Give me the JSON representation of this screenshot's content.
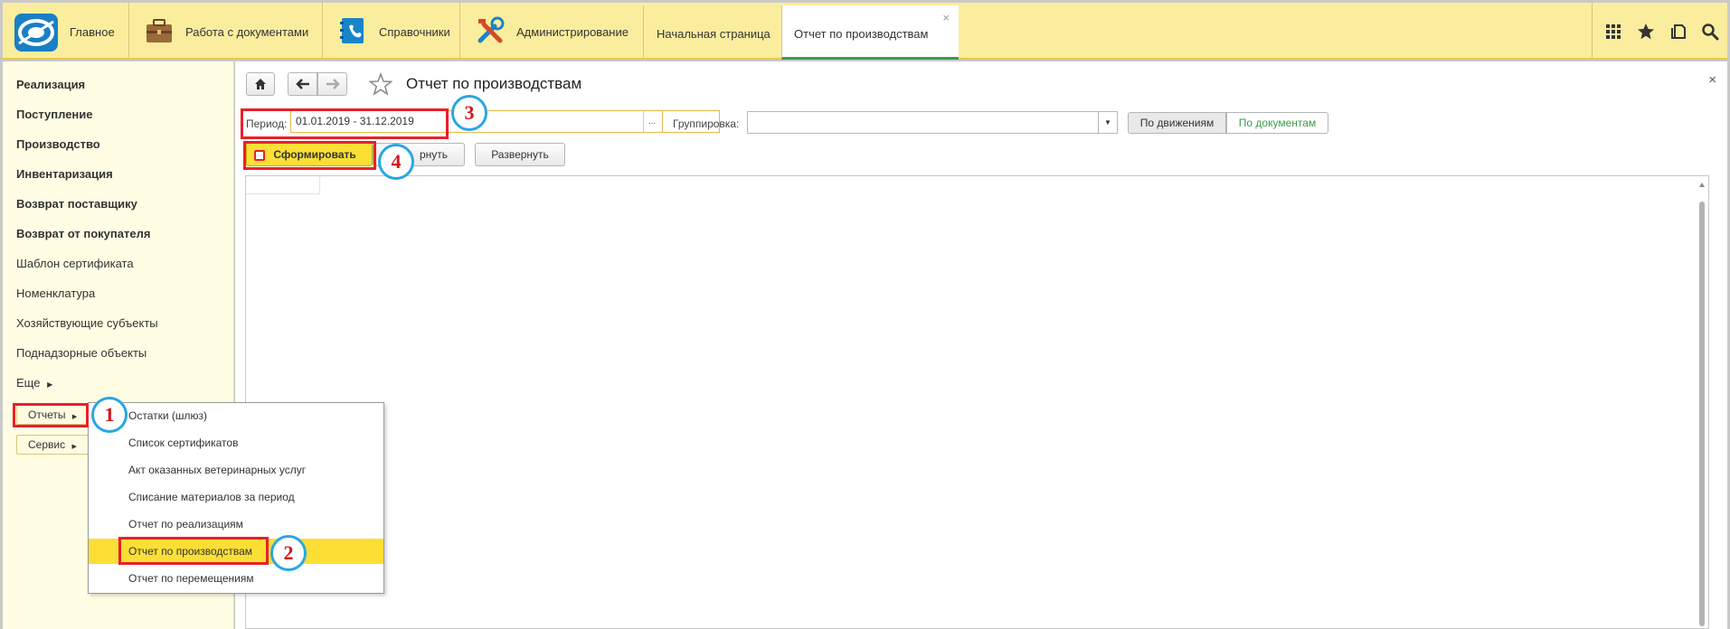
{
  "topbar": {
    "home_label": "Главное",
    "sections": [
      {
        "label": "Работа с документами",
        "icon": "briefcase-icon"
      },
      {
        "label": "Справочники",
        "icon": "address-book-icon"
      },
      {
        "label": "Администрирование",
        "icon": "tools-icon"
      }
    ],
    "tabs": [
      {
        "label": "Начальная страница"
      },
      {
        "label": "Отчет по производствам",
        "close": "×"
      }
    ],
    "right_icons": [
      "apps-grid-icon",
      "star-icon",
      "history-icon",
      "search-icon"
    ]
  },
  "sidebar": {
    "items": [
      {
        "label": "Реализация",
        "bold": true
      },
      {
        "label": "Поступление",
        "bold": true
      },
      {
        "label": "Производство",
        "bold": true
      },
      {
        "label": "Инвентаризация",
        "bold": true
      },
      {
        "label": "Возврат поставщику",
        "bold": true
      },
      {
        "label": "Возврат от покупателя",
        "bold": true
      },
      {
        "label": "Шаблон сертификата",
        "bold": false
      },
      {
        "label": "Номенклатура",
        "bold": false
      },
      {
        "label": "Хозяйствующие субъекты",
        "bold": false
      },
      {
        "label": "Поднадзорные объекты",
        "bold": false
      },
      {
        "label": "Еще",
        "bold": false
      }
    ],
    "reports_button": "Отчеты",
    "service_button": "Сервис"
  },
  "reports_menu": {
    "items": [
      "Остатки (шлюз)",
      "Список сертификатов",
      "Акт оказанных ветеринарных услуг",
      "Списание материалов за период",
      "Отчет по реализациям",
      "Отчет по производствам",
      "Отчет по перемещениям"
    ],
    "highlighted_index": 5
  },
  "main": {
    "title": "Отчет по производствам",
    "close": "×",
    "period_label": "Период:",
    "period_value": "01.01.2019 - 31.12.2019",
    "period_picker": "...",
    "grouping_label": "Группировка:",
    "grouping_value": "",
    "seg_by_movements": "По движениям",
    "seg_by_documents": "По документам",
    "generate_button": "Сформировать",
    "collapse_button": "Свернуть",
    "collapse_visible": "рнуть",
    "expand_button": "Развернуть"
  },
  "annotations": [
    "1",
    "2",
    "3",
    "4"
  ],
  "colors": {
    "topbar_bg": "#fbed9e",
    "sidebar_bg": "#fffde3",
    "highlight": "#fbdf35",
    "annotation_red": "#e8202a",
    "annotation_blue": "#2aa6e4",
    "active_tab_line": "#3a9c48",
    "link_green": "#3a9c48"
  }
}
